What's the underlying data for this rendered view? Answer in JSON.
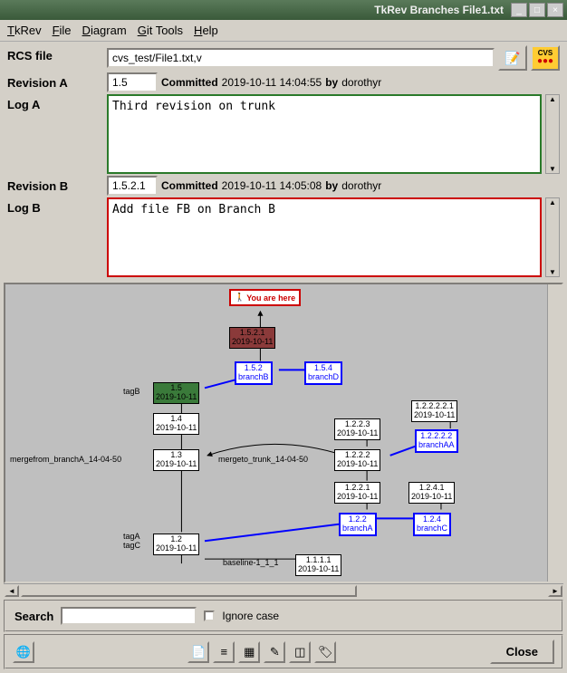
{
  "window": {
    "title": "TkRev Branches File1.txt"
  },
  "menu": {
    "tkrev": "TkRev",
    "file": "File",
    "diagram": "Diagram",
    "git": "Git Tools",
    "help": "Help"
  },
  "info": {
    "rcs_label": "RCS file",
    "rcs_value": "cvs_test/File1.txt,v",
    "revA_label": "Revision A",
    "revA_num": "1.5",
    "revA_committed": "Committed",
    "revA_date": "2019-10-11 14:04:55",
    "revA_by": "by",
    "revA_user": "dorothyr",
    "logA_label": "Log A",
    "logA_text": "Third revision on trunk",
    "revB_label": "Revision B",
    "revB_num": "1.5.2.1",
    "revB_committed": "Committed",
    "revB_date": "2019-10-11 14:05:08",
    "revB_by": "by",
    "revB_user": "dorothyr",
    "logB_label": "Log B",
    "logB_text": "Add file FB on Branch B"
  },
  "diagram": {
    "you_here": "You are here",
    "tagB": "tagB",
    "tagA": "tagA",
    "tagC": "tagC",
    "mergefrom": "mergefrom_branchA_14-04-50",
    "mergeto": "mergeto_trunk_14-04-50",
    "baseline": "baseline-1_1_1",
    "nodes": {
      "n1521": {
        "rev": "1.5.2.1",
        "date": "2019-10-11"
      },
      "n152": {
        "rev": "1.5.2",
        "name": "branchB"
      },
      "n154": {
        "rev": "1.5.4",
        "name": "branchD"
      },
      "n15": {
        "rev": "1.5",
        "date": "2019-10-11"
      },
      "n14": {
        "rev": "1.4",
        "date": "2019-10-11"
      },
      "n13": {
        "rev": "1.3",
        "date": "2019-10-11"
      },
      "n12": {
        "rev": "1.2",
        "date": "2019-10-11"
      },
      "n1223": {
        "rev": "1.2.2.3",
        "date": "2019-10-11"
      },
      "n1222": {
        "rev": "1.2.2.2",
        "date": "2019-10-11"
      },
      "n1221": {
        "rev": "1.2.2.1",
        "date": "2019-10-11"
      },
      "n122": {
        "rev": "1.2.2",
        "name": "branchA"
      },
      "n122221": {
        "rev": "1.2.2.2.2.1",
        "date": "2019-10-11"
      },
      "n12222": {
        "rev": "1.2.2.2.2",
        "name": "branchAA"
      },
      "n1241": {
        "rev": "1.2.4.1",
        "date": "2019-10-11"
      },
      "n124": {
        "rev": "1.2.4",
        "name": "branchC"
      },
      "n1111": {
        "rev": "1.1.1.1",
        "date": "2019-10-11"
      }
    }
  },
  "search": {
    "label": "Search",
    "placeholder": "",
    "ignore": "Ignore case"
  },
  "toolbar": {
    "close": "Close"
  }
}
